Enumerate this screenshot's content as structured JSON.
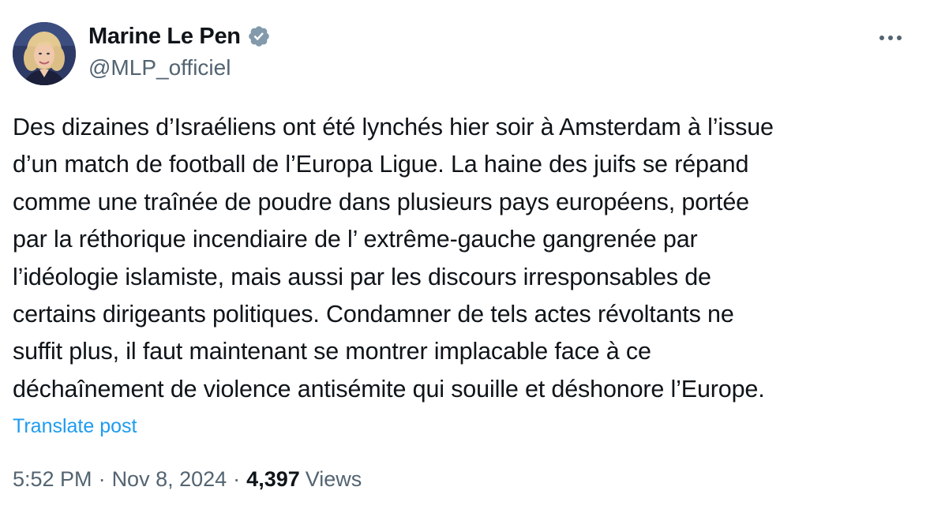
{
  "author": {
    "display_name": "Marine Le Pen",
    "handle": "@MLP_officiel",
    "verified_icon": "verified-badge-gray",
    "avatar_icon": "profile-photo"
  },
  "menu": {
    "more_icon": "more-horizontal-icon"
  },
  "post": {
    "text": "Des dizaines d’Israéliens ont été lynchés hier soir à Amsterdam à l’issue\nd’un match de football de l’Europa Ligue. La haine des juifs se répand\ncomme une traînée de poudre dans plusieurs pays européens, portée\npar la réthorique incendiaire de l’ extrême-gauche gangrenée par\nl’idéologie islamiste, mais aussi par les discours irresponsables de\ncertains dirigeants politiques. Condamner de tels actes révoltants ne\nsuffit plus, il faut maintenant se montrer implacable face à ce\ndéchaînement de violence antisémite qui souille et déshonore l’Europe.",
    "translate_label": "Translate post"
  },
  "meta": {
    "time": "5:52 PM",
    "separator": "·",
    "date": "Nov 8, 2024",
    "views_count": "4,397",
    "views_label": "Views"
  },
  "colors": {
    "text_primary": "#0f1419",
    "text_secondary": "#536471",
    "link": "#1d9bf0",
    "verified_badge": "#829aab"
  }
}
